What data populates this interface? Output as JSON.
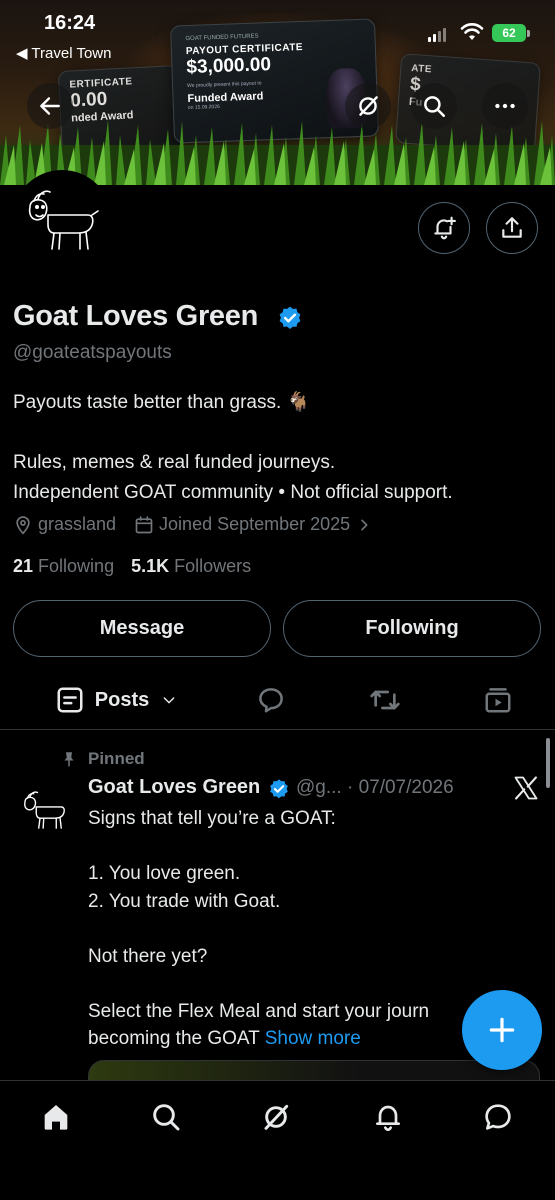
{
  "status_bar": {
    "time": "16:24",
    "back_app": "◀ Travel Town",
    "battery": "62"
  },
  "banner": {
    "cert_center": {
      "logo": "GOAT FUNDED FUTURES",
      "title": "PAYOUT CERTIFICATE",
      "amount": "$3,000.00",
      "sub": "We proudly present this payout to",
      "award": "Funded Award",
      "date": "on 15.09.2026"
    },
    "cert_left": {
      "title": "ERTIFICATE",
      "amount": "0.00",
      "award": "nded Award"
    },
    "cert_right": {
      "title": "ATE",
      "amount": "$",
      "award": "Fu"
    },
    "buttons": [
      "back-arrow-icon",
      "grok-icon",
      "search-icon",
      "more-icon"
    ]
  },
  "profile": {
    "name": "Goat Loves Green",
    "handle": "@goateatspayouts",
    "bio_line1": "Payouts taste better than grass. 🐐",
    "bio_line2": "Rules, memes & real funded journeys.",
    "bio_line3": "Independent GOAT community • Not official support.",
    "location": "grassland",
    "joined": "Joined September 2025",
    "following_count": "21",
    "following_label": "Following",
    "followers_count": "5.1K",
    "followers_label": "Followers",
    "message_label": "Message",
    "following_button_label": "Following"
  },
  "tabs": {
    "posts_label": "Posts"
  },
  "post": {
    "pinned_label": "Pinned",
    "author": "Goat Loves Green",
    "handle_date": "@g... · 07/07/2026",
    "text": "Signs that tell you’re a GOAT:\n\n1. You love green.\n2. You trade with Goat.\n\nNot there yet?\n\nSelect the Flex Meal and start your journ\nbecoming the GOAT",
    "show_more": "Show more"
  },
  "colors": {
    "accent": "#1d9bf0",
    "background": "#000000",
    "text_primary": "#e7e9ea",
    "text_secondary": "#71767b",
    "border": "#536471",
    "battery": "#36c759"
  }
}
